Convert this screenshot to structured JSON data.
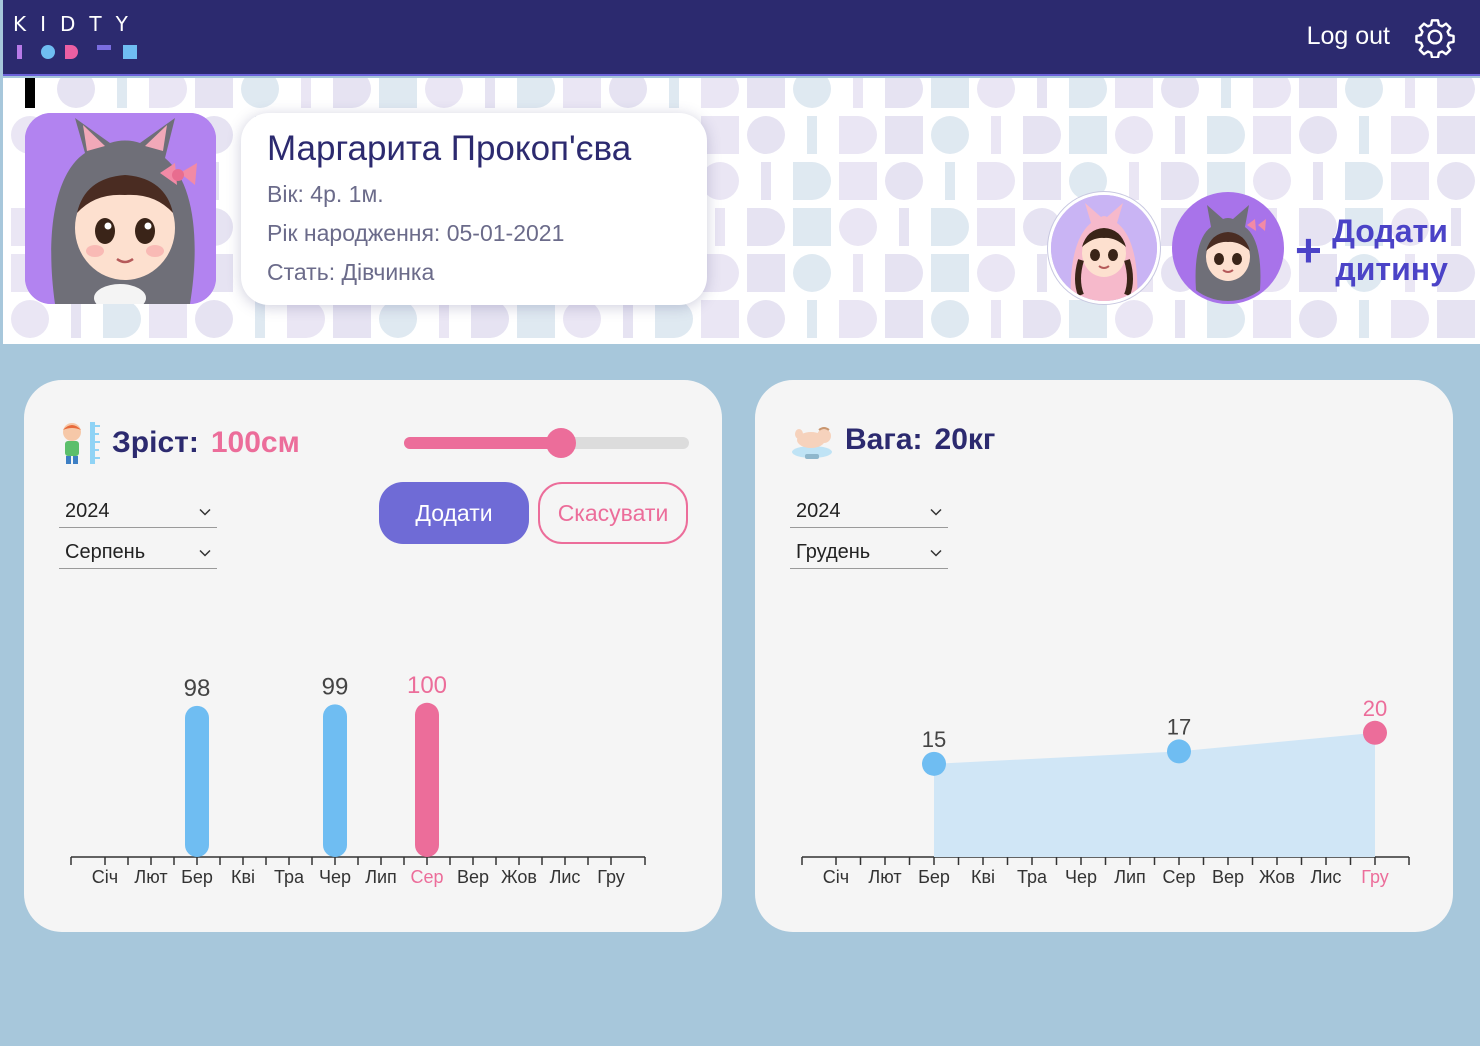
{
  "header": {
    "logo_text": "KIDTY",
    "logout_label": "Log out"
  },
  "profile": {
    "name": "Маргарита Прокоп'єва",
    "age": "Вік: 4р. 1м.",
    "birth": "Рік народження: 05-01-2021",
    "gender": "Стать: Дівчинка"
  },
  "add_child": {
    "line1": "Додати",
    "line2": "дитину"
  },
  "height_card": {
    "title": "Зріст:",
    "value": "100см",
    "year": "2024",
    "month": "Серпень",
    "add_label": "Додати",
    "cancel_label": "Скасувати",
    "slider_fraction": 0.55
  },
  "weight_card": {
    "title": "Вага:",
    "value": "20кг",
    "year": "2024",
    "month": "Грудень"
  },
  "colors": {
    "accent_pink": "#ec6d9a",
    "accent_blue": "#6fbdf2",
    "navy": "#2c2a6f",
    "purple": "#6f6bd6"
  },
  "chart_data": [
    {
      "type": "bar",
      "categories": [
        "Січ",
        "Лют",
        "Бер",
        "Кві",
        "Тра",
        "Чер",
        "Лип",
        "Сер",
        "Вер",
        "Жов",
        "Лис",
        "Гру"
      ],
      "values": [
        null,
        null,
        98,
        null,
        null,
        99,
        null,
        100,
        null,
        null,
        null,
        null
      ],
      "highlight": "Сер",
      "ylim": [
        0,
        100
      ]
    },
    {
      "type": "area",
      "categories": [
        "Січ",
        "Лют",
        "Бер",
        "Кві",
        "Тра",
        "Чер",
        "Лип",
        "Сер",
        "Вер",
        "Жов",
        "Лис",
        "Гру"
      ],
      "values": [
        null,
        null,
        15,
        null,
        null,
        null,
        null,
        17,
        null,
        null,
        null,
        20
      ],
      "highlight": "Гру",
      "ylim": [
        0,
        24
      ]
    }
  ]
}
